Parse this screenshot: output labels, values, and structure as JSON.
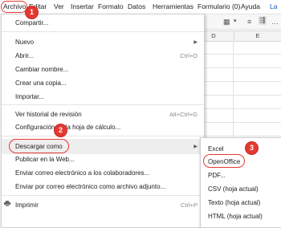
{
  "menubar": {
    "items": [
      "Archivo",
      "Editar",
      "Ver",
      "Insertar",
      "Formato",
      "Datos",
      "Herramientas",
      "Formulario (0)",
      "Ayuda",
      "La"
    ]
  },
  "sheet": {
    "columns": [
      "D",
      "E"
    ]
  },
  "file_menu": {
    "items": [
      {
        "label": "Compartir..."
      },
      {
        "label": "Nuevo"
      },
      {
        "label": "Abrir...",
        "shortcut": "Ctrl+O"
      },
      {
        "label": "Cambiar nombre..."
      },
      {
        "label": "Crear una copia..."
      },
      {
        "label": "Importar..."
      },
      {
        "label": "Ver historial de revisión",
        "shortcut": "Alt+Ctrl+G"
      },
      {
        "label": "Configuración de la hoja de cálculo..."
      },
      {
        "label": "Descargar como"
      },
      {
        "label": "Publicar en la Web..."
      },
      {
        "label": "Enviar correo electrónico a los colaboradores..."
      },
      {
        "label": "Enviar por correo electrónico como archivo adjunto..."
      },
      {
        "label": "Imprimir",
        "shortcut": "Ctrl+P"
      }
    ]
  },
  "download_submenu": {
    "items": [
      "Excel",
      "OpenOffice",
      "PDF...",
      "CSV (hoja actual)",
      "Texto (hoja actual)",
      "HTML (hoja actual)"
    ]
  },
  "annotations": {
    "step1": "1",
    "step2": "2",
    "step3": "3",
    "color": "#e53935"
  },
  "icons": {
    "submenu_arrow": "triangle-right",
    "print": "printer-icon"
  }
}
